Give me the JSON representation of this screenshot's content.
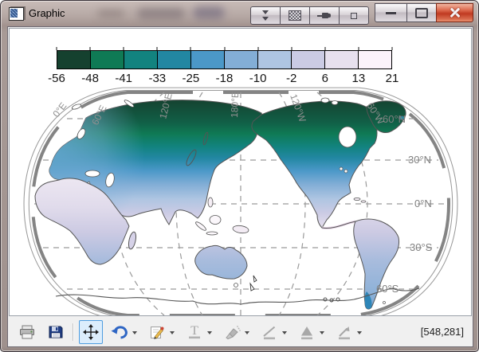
{
  "window": {
    "title": "Graphic"
  },
  "titlebar": {
    "buttons": [
      {
        "name": "collapse",
        "icon": "double-chevron-down-icon"
      },
      {
        "name": "pattern",
        "icon": "dither-square-icon"
      },
      {
        "name": "pin",
        "icon": "push-pin-icon"
      },
      {
        "name": "box",
        "icon": "small-box-icon"
      },
      {
        "name": "minimize",
        "icon": "minimize-icon"
      },
      {
        "name": "maximize",
        "icon": "maximize-icon"
      },
      {
        "name": "close",
        "icon": "close-x-icon"
      }
    ]
  },
  "colorbar": {
    "tick_labels": [
      "-56",
      "-48",
      "-41",
      "-33",
      "-25",
      "-18",
      "-10",
      "-2",
      "6",
      "13",
      "21"
    ],
    "colors": [
      "#15412f",
      "#0f7a55",
      "#12837f",
      "#2287a2",
      "#4b98c8",
      "#83aed6",
      "#aec5e2",
      "#cbcbe4",
      "#e7e0ee",
      "#fbf3fa"
    ]
  },
  "map": {
    "lat_labels": [
      "60°N",
      "30°N",
      "0°N",
      "30°S",
      "60°S"
    ],
    "lon_labels": [
      "0°E",
      "60°E",
      "120°E",
      "180°E",
      "120°W",
      "60°W"
    ]
  },
  "toolbar": {
    "tools": [
      {
        "name": "print",
        "enabled": true,
        "dropdown": false
      },
      {
        "name": "save",
        "enabled": true,
        "dropdown": false
      },
      {
        "name": "pan",
        "enabled": true,
        "dropdown": false,
        "active": true
      },
      {
        "name": "undo",
        "enabled": true,
        "dropdown": true
      },
      {
        "name": "edit",
        "enabled": true,
        "dropdown": true
      },
      {
        "name": "text",
        "enabled": false,
        "dropdown": true
      },
      {
        "name": "ink",
        "enabled": false,
        "dropdown": true
      },
      {
        "name": "line",
        "enabled": false,
        "dropdown": true
      },
      {
        "name": "polygon",
        "enabled": false,
        "dropdown": true
      },
      {
        "name": "arrow",
        "enabled": false,
        "dropdown": true
      }
    ],
    "coordinates": "[548,281]"
  },
  "chart_data": {
    "type": "heatmap",
    "title": "",
    "description": "Filled-contour world map (pseudocylindrical/Robinson-style projection centered on 180° longitude) of a temperature-like field over land; oceans and Antarctica unfilled (white).",
    "colorbar": {
      "boundaries": [
        -56,
        -48,
        -41,
        -33,
        -25,
        -18,
        -10,
        -2,
        6,
        13,
        21
      ],
      "colors": [
        "#15412f",
        "#0f7a55",
        "#12837f",
        "#2287a2",
        "#4b98c8",
        "#83aed6",
        "#aec5e2",
        "#cbcbe4",
        "#e7e0ee",
        "#fbf3fa"
      ]
    },
    "graticule": {
      "latitude_labels": [
        "60°N",
        "30°N",
        "0°N",
        "30°S",
        "60°S"
      ],
      "longitude_labels": [
        "0°E",
        "60°E",
        "120°E",
        "180°E",
        "120°W",
        "60°W"
      ],
      "style": "dashed gray"
    },
    "qualitative_values": [
      {
        "region": "Siberia / Russian Arctic",
        "value_range": [
          -56,
          -41
        ]
      },
      {
        "region": "Northern Canada / Alaska / Greenland",
        "value_range": [
          -56,
          -33
        ]
      },
      {
        "region": "Scandinavia / Northern Europe",
        "value_range": [
          -33,
          -18
        ]
      },
      {
        "region": "Central Europe / Central Asia / Japan",
        "value_range": [
          -18,
          -2
        ]
      },
      {
        "region": "Mediterranean / Middle East / China",
        "value_range": [
          -10,
          6
        ]
      },
      {
        "region": "North Africa / India / Mexico / SE Asia",
        "value_range": [
          6,
          21
        ]
      },
      {
        "region": "Southern Africa / Australia / South America interior",
        "value_range": [
          -2,
          13
        ]
      },
      {
        "region": "Patagonia / Andes tip",
        "value_range": [
          -25,
          -10
        ]
      }
    ]
  }
}
